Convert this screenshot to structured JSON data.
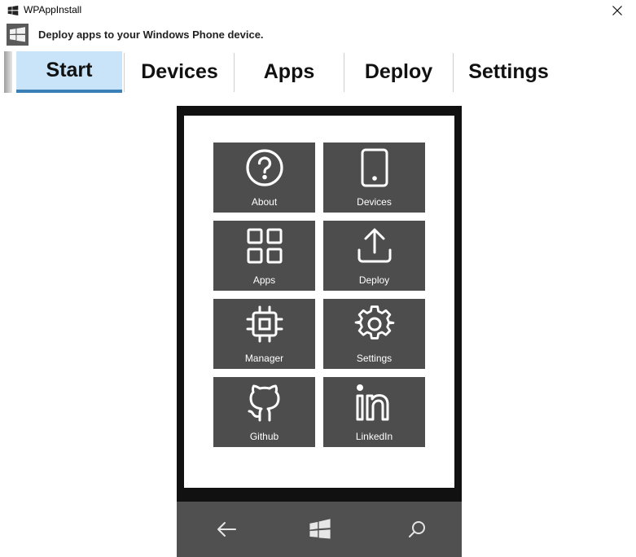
{
  "window": {
    "title": "WPAppInstall"
  },
  "header": {
    "subtitle": "Deploy apps to your Windows Phone device."
  },
  "tabs": [
    {
      "label": "Start",
      "active": true
    },
    {
      "label": "Devices",
      "active": false
    },
    {
      "label": "Apps",
      "active": false
    },
    {
      "label": "Deploy",
      "active": false
    },
    {
      "label": "Settings",
      "active": false
    }
  ],
  "tiles": [
    {
      "label": "About",
      "icon": "help-circle-icon"
    },
    {
      "label": "Devices",
      "icon": "phone-icon"
    },
    {
      "label": "Apps",
      "icon": "apps-grid-icon"
    },
    {
      "label": "Deploy",
      "icon": "upload-icon"
    },
    {
      "label": "Manager",
      "icon": "chip-icon"
    },
    {
      "label": "Settings",
      "icon": "gear-icon"
    },
    {
      "label": "Github",
      "icon": "github-icon"
    },
    {
      "label": "LinkedIn",
      "icon": "linkedin-icon"
    }
  ],
  "phone_nav": {
    "back": "back-arrow-icon",
    "home": "windows-logo-icon",
    "search": "search-icon"
  },
  "colors": {
    "tile": "#4d4d4d",
    "active_tab": "#c9e4f8",
    "active_underline": "#3a7fb5",
    "phone_bezel": "#111111",
    "phone_nav": "#505050"
  }
}
